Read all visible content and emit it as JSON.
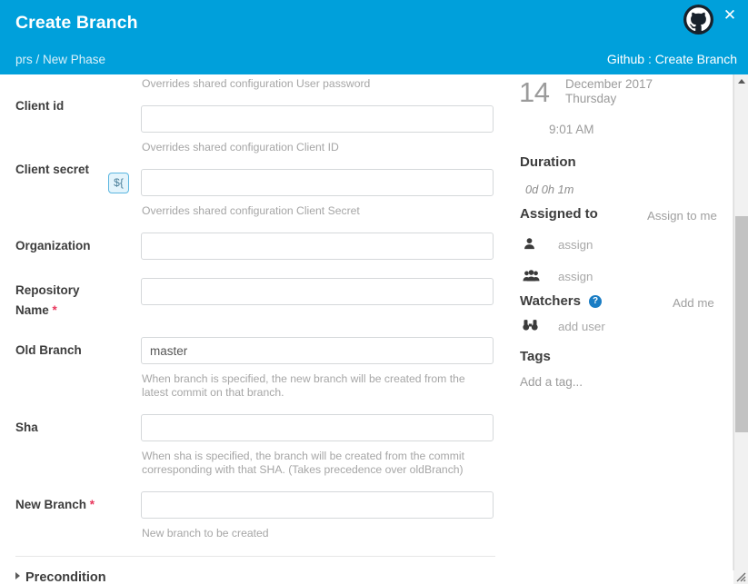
{
  "header": {
    "title": "Create Branch",
    "breadcrumb": "prs / New Phase",
    "context": "Github : Create Branch",
    "logo_icon": "github-octocat-icon",
    "close_icon": "close-icon",
    "accent_color": "#00a0db"
  },
  "form": {
    "top_help": "Overrides shared configuration User password",
    "fields": [
      {
        "label": "Client id",
        "required": false,
        "value": "",
        "placeholder": "",
        "help": "Overrides shared configuration Client ID",
        "variable_button": null
      },
      {
        "label": "Client secret",
        "required": false,
        "value": "",
        "placeholder": "",
        "help": "Overrides shared configuration Client Secret",
        "variable_button": "${"
      },
      {
        "label": "Organization",
        "required": false,
        "value": "",
        "placeholder": "",
        "help": "",
        "variable_button": null
      },
      {
        "label": "Repository Name",
        "required": true,
        "value": "",
        "placeholder": "",
        "help": "",
        "variable_button": null
      },
      {
        "label": "Old Branch",
        "required": false,
        "value": "master",
        "placeholder": "",
        "help": "When branch is specified, the new branch will be created from the latest commit on that branch.",
        "variable_button": null
      },
      {
        "label": "Sha",
        "required": false,
        "value": "",
        "placeholder": "",
        "help": "When sha is specified, the branch will be created from the commit corresponding with that SHA. (Takes precedence over oldBranch)",
        "variable_button": null
      },
      {
        "label": "New Branch",
        "required": true,
        "value": "",
        "placeholder": "",
        "help": "New branch to be created",
        "variable_button": null
      }
    ],
    "required_marker": "*",
    "section": {
      "label": "Precondition",
      "expanded": false,
      "caret_icon": "caret-right-icon"
    }
  },
  "sidebar": {
    "date": {
      "day": "14",
      "month_year": "December 2017",
      "weekday": "Thursday",
      "time": "9:01 AM"
    },
    "duration": {
      "heading": "Duration",
      "value": "0d 0h 1m"
    },
    "assigned": {
      "heading": "Assigned to",
      "action": "Assign to me",
      "user_row": {
        "icon": "user-icon",
        "label": "assign"
      },
      "group_row": {
        "icon": "users-group-icon",
        "label": "assign"
      }
    },
    "watchers": {
      "heading": "Watchers",
      "help_icon": "help-question-icon",
      "help_glyph": "?",
      "action": "Add me",
      "row": {
        "icon": "binoculars-icon",
        "label": "add user"
      }
    },
    "tags": {
      "heading": "Tags",
      "add_label": "Add a tag..."
    }
  },
  "scrollbar": {
    "up_arrow_icon": "scroll-up-arrow-icon",
    "thumb_icon": "scroll-thumb",
    "resize_grip_icon": "resize-grip-icon"
  }
}
